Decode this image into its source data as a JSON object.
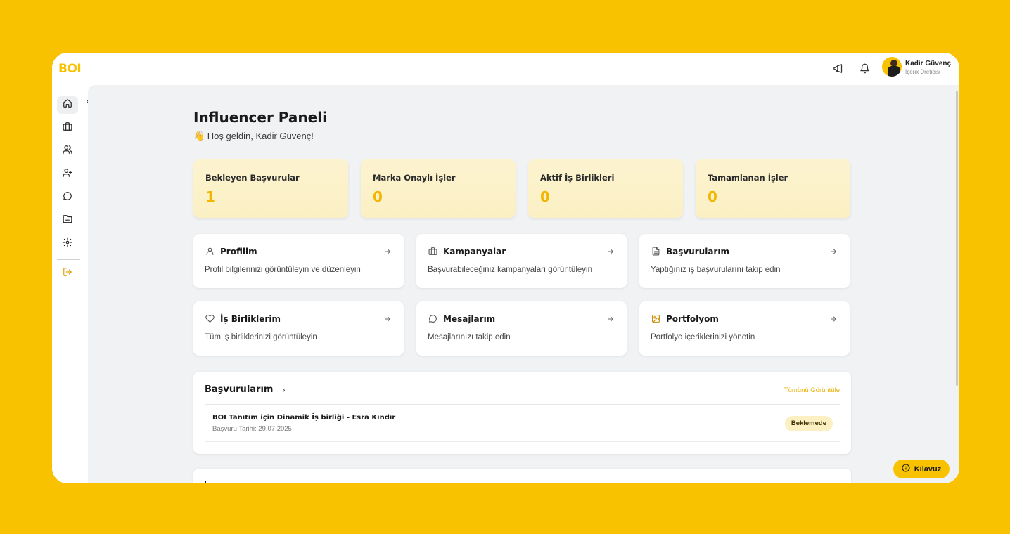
{
  "app": {
    "logo": "BOI"
  },
  "header": {
    "user_name": "Kadir Güvenç",
    "user_role": "İçerik Üreticisi",
    "icons": [
      "megaphone-icon",
      "bell-icon"
    ]
  },
  "sidebar": {
    "items": [
      {
        "name": "home",
        "icon": "home-icon",
        "active": true
      },
      {
        "name": "briefcase",
        "icon": "briefcase-icon",
        "active": false
      },
      {
        "name": "users",
        "icon": "users-icon",
        "active": false
      },
      {
        "name": "user-plus",
        "icon": "user-plus-icon",
        "active": false
      },
      {
        "name": "messages",
        "icon": "message-icon",
        "active": false
      },
      {
        "name": "folder",
        "icon": "folder-icon",
        "active": false
      },
      {
        "name": "settings",
        "icon": "gear-icon",
        "active": false
      }
    ],
    "logout_icon": "logout-icon",
    "expand_icon": "chevron-right-icon"
  },
  "main": {
    "title": "Influencer Paneli",
    "welcome": "👋 Hoş geldin, Kadir Güvenç!",
    "stats": [
      {
        "label": "Bekleyen Başvurular",
        "value": "1"
      },
      {
        "label": "Marka Onaylı İşler",
        "value": "0"
      },
      {
        "label": "Aktif İş Birlikleri",
        "value": "0"
      },
      {
        "label": "Tamamlanan İşler",
        "value": "0"
      }
    ],
    "cards": [
      {
        "title": "Profilim",
        "desc": "Profil bilgilerinizi görüntüleyin ve düzenleyin",
        "icon": "user-icon"
      },
      {
        "title": "Kampanyalar",
        "desc": "Başvurabileceğiniz kampanyaları görüntüleyin",
        "icon": "briefcase-icon"
      },
      {
        "title": "Başvurularım",
        "desc": "Yaptığınız iş başvurularını takip edin",
        "icon": "document-icon"
      },
      {
        "title": "İş Birliklerim",
        "desc": "Tüm iş birliklerinizi görüntüleyin",
        "icon": "heart-icon"
      },
      {
        "title": "Mesajlarım",
        "desc": "Mesajlarınızı takip edin",
        "icon": "message-icon"
      },
      {
        "title": "Portfolyom",
        "desc": "Portfolyo içeriklerinizi yönetin",
        "icon": "image-icon"
      }
    ],
    "applications": {
      "title": "Başvurularım",
      "view_all": "Tümünü Görüntüle",
      "items": [
        {
          "title": "BOI Tanıtım için Dinamik İş birliği - Esra Kındır",
          "date": "Başvuru Tarihi: 29.07.2025",
          "status": "Beklemede"
        }
      ]
    }
  },
  "guide_button": {
    "label": "Kılavuz",
    "icon": "info-icon"
  },
  "colors": {
    "accent": "#F9C200",
    "background": "#F9C200",
    "main_bg": "#F1F2F4"
  }
}
